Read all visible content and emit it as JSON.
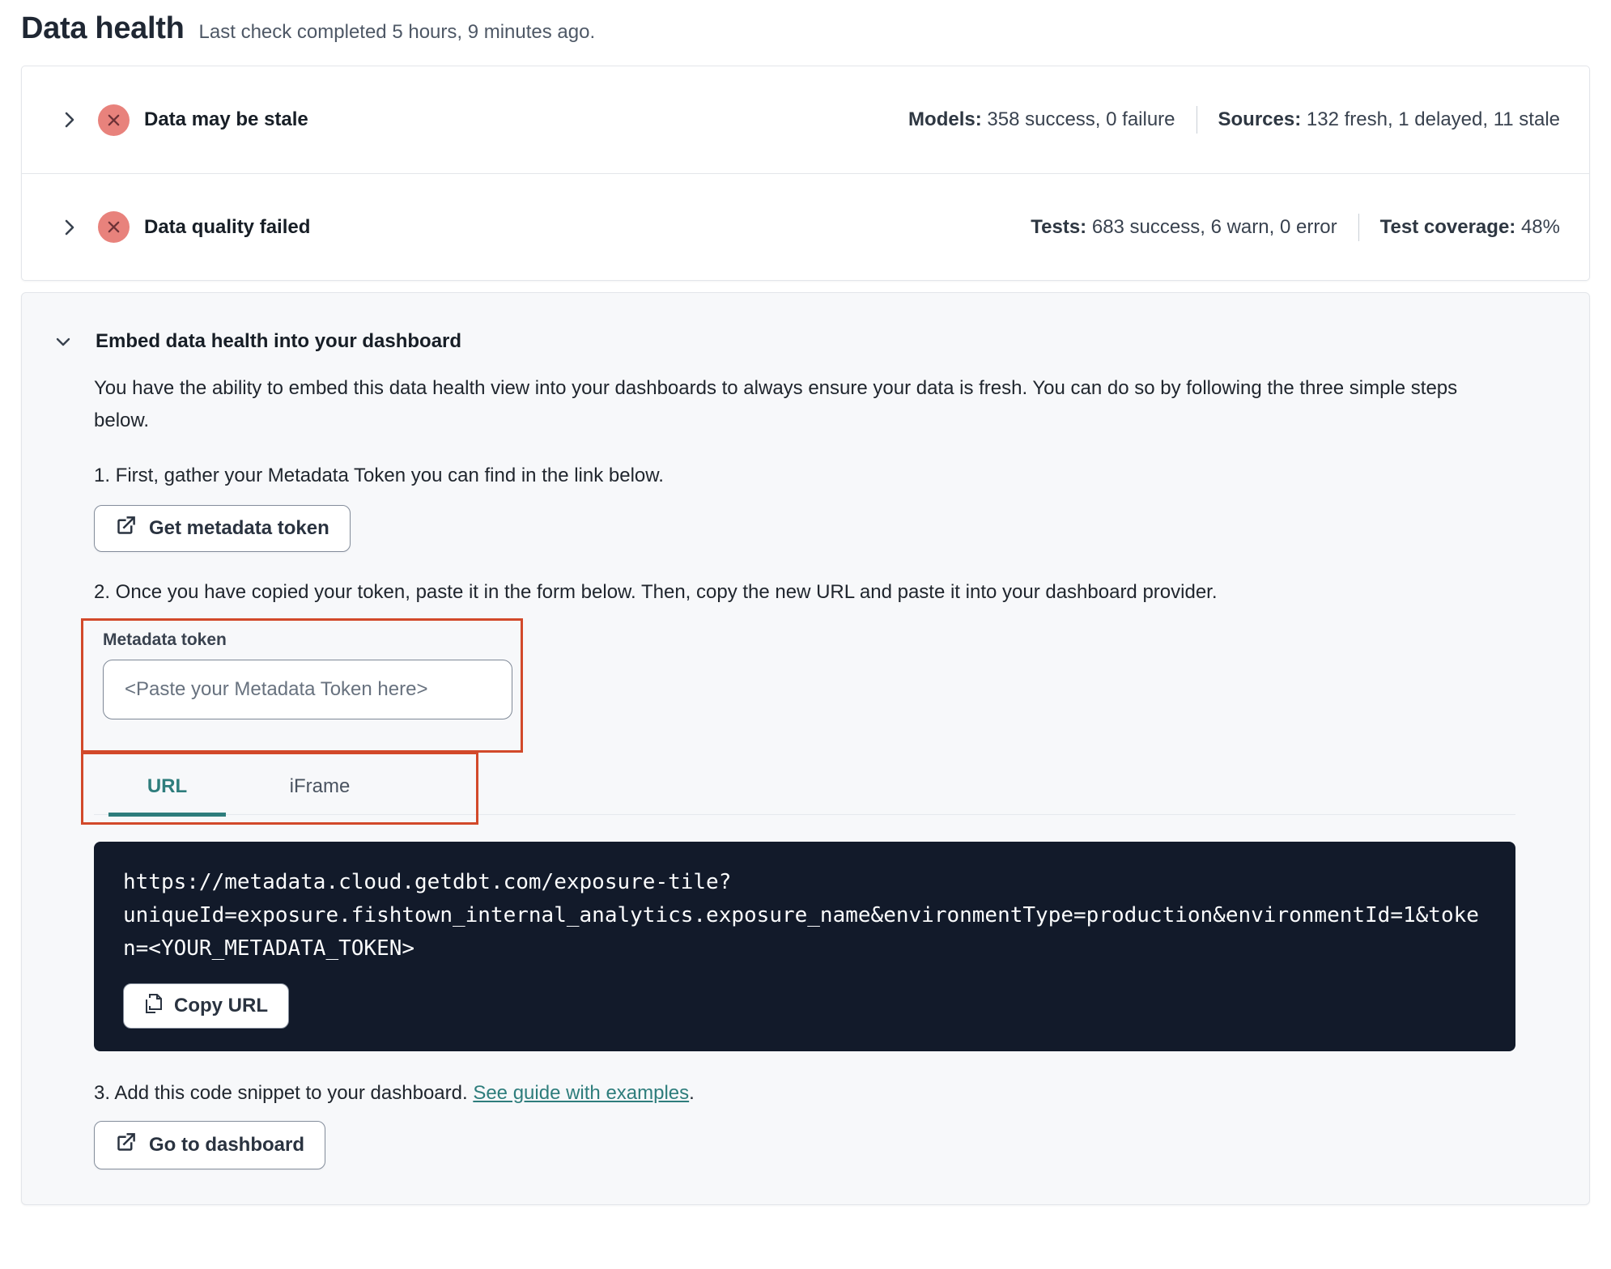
{
  "page": {
    "title": "Data health",
    "subtitle": "Last check completed 5 hours, 9 minutes ago."
  },
  "status_rows": [
    {
      "title": "Data may be stale",
      "expand_icon": "chevron-right-icon",
      "status_icon": "x-circle-icon",
      "stats": [
        {
          "label": "Models:",
          "value": "358 success, 0 failure"
        },
        {
          "label": "Sources:",
          "value": "132 fresh, 1 delayed, 11 stale"
        }
      ]
    },
    {
      "title": "Data quality failed",
      "expand_icon": "chevron-right-icon",
      "status_icon": "x-circle-icon",
      "stats": [
        {
          "label": "Tests:",
          "value": "683 success, 6 warn, 0 error"
        },
        {
          "label": "Test coverage:",
          "value": "48%"
        }
      ]
    }
  ],
  "embed": {
    "collapse_icon": "chevron-down-icon",
    "title": "Embed data health into your dashboard",
    "description": "You have the ability to embed this data health view into your dashboards to always ensure your data is fresh. You can do so by following the three simple steps below.",
    "step1": "1. First, gather your Metadata Token you can find in the link below.",
    "get_token_button": {
      "label": "Get metadata token",
      "icon": "external-link-icon"
    },
    "step2": "2. Once you have copied your token, paste it in the form below. Then, copy the new URL and paste it into your dashboard provider.",
    "token_label": "Metadata token",
    "token_placeholder": "<Paste your Metadata Token here>",
    "tabs": [
      {
        "label": "URL",
        "active": true
      },
      {
        "label": "iFrame",
        "active": false
      }
    ],
    "code_url": "https://metadata.cloud.getdbt.com/exposure-tile?uniqueId=exposure.fishtown_internal_analytics.exposure_name&environmentType=production&environmentId=1&token=<YOUR_METADATA_TOKEN>",
    "copy_button": {
      "label": "Copy URL",
      "icon": "copy-icon"
    },
    "step3_prefix": "3. Add this code snippet to your dashboard. ",
    "step3_link": "See guide with examples",
    "step3_suffix": ".",
    "dashboard_button": {
      "label": "Go to dashboard",
      "icon": "external-link-icon"
    }
  },
  "colors": {
    "annotation_red": "#D2492A",
    "accent_teal": "#2E7D7C",
    "status_error_badge": "#E8827C",
    "status_error_x": "#6E3237",
    "code_background": "#121A2A",
    "card_background": "#F7F8FA"
  }
}
